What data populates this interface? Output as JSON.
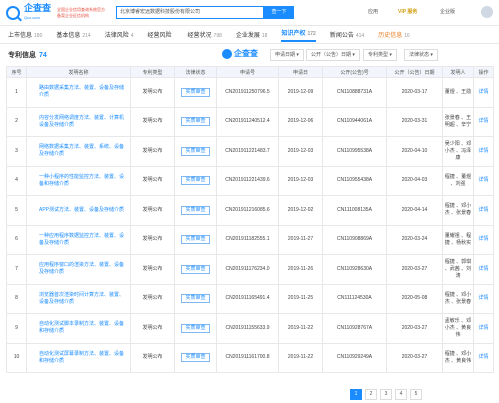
{
  "header": {
    "logo_name": "企查查",
    "logo_sub": "Qcc.com",
    "badge_line1": "全国企业信用查询系统官方",
    "badge_line2": "备案企业征信机构",
    "search_value": "北京博睿宏远数据科技股份有限公司",
    "search_button": "查一下",
    "app_label": "应用",
    "vip_label": "VIP 服务",
    "enterprise_label": "企业版"
  },
  "tabs": [
    {
      "label": "上市信息",
      "count": "180"
    },
    {
      "label": "基本信息",
      "count": "214"
    },
    {
      "label": "法律风险",
      "count": "4"
    },
    {
      "label": "经营风险",
      "count": ""
    },
    {
      "label": "经营状况",
      "count": "798"
    },
    {
      "label": "企业发展",
      "count": "18"
    },
    {
      "label": "知识产权",
      "count": "172"
    },
    {
      "label": "新闻公告",
      "count": "414"
    },
    {
      "label": "历史信息",
      "count": "16"
    }
  ],
  "section": {
    "title": "专利信息",
    "count": "74",
    "qcc_text": "企查查",
    "filters": [
      "申请日期",
      "公开（公告）日期",
      "专利类型",
      "法律状态"
    ]
  },
  "table": {
    "headers": [
      "序号",
      "发明名称",
      "专利类型",
      "法律状态",
      "申请号",
      "申请日",
      "公开(公告)号",
      "公开（公告）日期",
      "发明人",
      "操作"
    ],
    "rows": [
      {
        "idx": "1",
        "title": "路由数据采集方法、装置、设备及存储介质",
        "type": "发明公布",
        "status": "实质审查",
        "app_no": "CN201911250796.5",
        "app_date": "2019-12-09",
        "pub_no": "CN110888731A",
        "pub_date": "2020-03-17",
        "inventor": "董煜 、王勋",
        "op": "详情"
      },
      {
        "idx": "2",
        "title": "内容分发网络调度方法、装置、计算机设备及存储介质",
        "type": "发明公布",
        "status": "实质审查",
        "app_no": "CN201911240512.4",
        "app_date": "2019-12-06",
        "pub_no": "CN110944061A",
        "pub_date": "2020-03-31",
        "inventor": "张景春 、王明超 、辛宁",
        "op": "详情"
      },
      {
        "idx": "3",
        "title": "网络数据采集方法、装置、系统、设备及存储介质",
        "type": "发明公布",
        "status": "实质审查",
        "app_no": "CN201911221483.7",
        "app_date": "2019-12-03",
        "pub_no": "CN110995538A",
        "pub_date": "2020-04-10",
        "inventor": "吴少阳 、邓小杰 、冯泽康",
        "op": "详情"
      },
      {
        "idx": "4",
        "title": "一种小程序的性能监控方法、装置、设备和存储介质",
        "type": "发明公布",
        "status": "实质审查",
        "app_no": "CN201911221439.6",
        "app_date": "2019-12-03",
        "pub_no": "CN110955438A",
        "pub_date": "2020-04-03",
        "inventor": "程捷 、董煜 、刘强",
        "op": "详情"
      },
      {
        "idx": "5",
        "title": "APP测试方法、装置、设备及存储介质",
        "type": "发明公布",
        "status": "实质审查",
        "app_no": "CN201911216085.6",
        "app_date": "2019-12-02",
        "pub_no": "CN111008135A",
        "pub_date": "2020-04-14",
        "inventor": "程捷 、邓小杰 、张景春",
        "op": "详情"
      },
      {
        "idx": "6",
        "title": "一种应用程序数据监控方法、装置、设备及存储介质",
        "type": "发明公布",
        "status": "实质审查",
        "app_no": "CN201911182555.1",
        "app_date": "2019-11-27",
        "pub_no": "CN110908869A",
        "pub_date": "2020-03-24",
        "inventor": "董耀祖 、程捷 、杨秋实",
        "op": "详情"
      },
      {
        "idx": "7",
        "title": "应用程序窗口的渲染方法、装置、设备及存储介质",
        "type": "发明公布",
        "status": "实质审查",
        "app_no": "CN201911176234.0",
        "app_date": "2019-11-26",
        "pub_no": "CN110928630A",
        "pub_date": "2020-03-27",
        "inventor": "程捷 、郭琪 、武茜 、刘涛",
        "op": "详情"
      },
      {
        "idx": "8",
        "title": "浏览器首次渲染时间计算方法、装置、设备及存储介质",
        "type": "发明公布",
        "status": "实质审查",
        "app_no": "CN201911165491.4",
        "app_date": "2019-11-25",
        "pub_no": "CN111124530A",
        "pub_date": "2020-05-08",
        "inventor": "程捷 、邓小杰 、张景春",
        "op": "详情"
      },
      {
        "idx": "9",
        "title": "自动化测试脚本录制方法、装置、设备和存储介质",
        "type": "发明公布",
        "status": "实质审查",
        "app_no": "CN201911155633.9",
        "app_date": "2019-11-22",
        "pub_no": "CN110928767A",
        "pub_date": "2020-03-27",
        "inventor": "孟敏乐 、邓小杰 、黄良伟",
        "op": "详情"
      },
      {
        "idx": "10",
        "title": "自动化测试屏幕录制方法、装置、设备和存储介质",
        "type": "发明公布",
        "status": "实质审查",
        "app_no": "CN201911161700.8",
        "app_date": "2019-11-22",
        "pub_no": "CN110929249A",
        "pub_date": "2020-03-27",
        "inventor": "程捷 、邓小杰 、黄良伟",
        "op": "详情"
      }
    ]
  },
  "pager": [
    "1",
    "2",
    "3",
    "4",
    "5"
  ]
}
